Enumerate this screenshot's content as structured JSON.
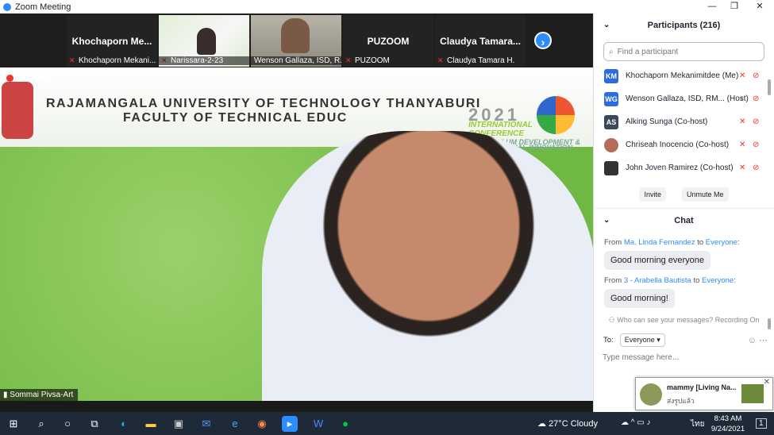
{
  "window": {
    "title": "Zoom Meeting",
    "controls": [
      "—",
      "❐",
      "✕"
    ]
  },
  "strip": {
    "tiles": [
      {
        "bigname": "Khochaporn  Me...",
        "caption": "Khochaporn Mekani..."
      },
      {
        "bigname": "",
        "caption": "Narissara-2-23"
      },
      {
        "bigname": "",
        "caption": "Wenson Gallaza, ISD, R..."
      },
      {
        "bigname": "PUZOOM",
        "caption": "PUZOOM"
      },
      {
        "bigname": "Claudya  Tamara...",
        "caption": "Claudya Tamara H."
      }
    ],
    "next_icon": "›"
  },
  "main": {
    "recording_label": "Recording",
    "speaker_name": "Sommai Pivsa-Art",
    "banner": {
      "university": "RAJAMANGALA UNIVERSITY OF TECHNOLOGY THANYABURI",
      "faculty": "FACULTY OF TECHNICAL EDUC",
      "conf_year": "2021",
      "conf_line1": "INTERNATIONAL",
      "conf_line2": "CONFERENCE",
      "conf_line3": "CURRICULUM DEVELOPMENT &",
      "conf_line4": "INSTRUCTIONAL INNOVATION"
    }
  },
  "participants": {
    "header": "Participants (216)",
    "search_placeholder": "Find a participant",
    "list": [
      {
        "initials": "KM",
        "name": "Khochaporn Mekanimitdee (Me)",
        "color": "#2D6CDF",
        "mic": "off"
      },
      {
        "initials": "WG",
        "name": "Wenson Gallaza, ISD, RM... (Host)",
        "color": "#2D6CDF",
        "mic": "on"
      },
      {
        "initials": "AS",
        "name": "Alking Sunga (Co-host)",
        "color": "#3a4a5c",
        "mic": "off"
      },
      {
        "initials": "",
        "name": "Chriseah Inocencio (Co-host)",
        "color": "#b56a5a",
        "mic": "off"
      },
      {
        "initials": "",
        "name": "John Joven Ramirez (Co-host)",
        "color": "#333333",
        "mic": "off"
      }
    ],
    "invite_label": "Invite",
    "unmute_label": "Unmute Me"
  },
  "chat": {
    "header": "Chat",
    "messages": [
      {
        "from_prefix": "From ",
        "sender": "Ma. Linda Fernandez",
        "to": " to ",
        "recipient": "Everyone",
        "suffix": ":",
        "text": "Good morning everyone"
      },
      {
        "from_prefix": "From ",
        "sender": "3 - Arabella Bautista",
        "to": " to ",
        "recipient": "Everyone",
        "suffix": ":",
        "text": "Good morning!"
      }
    ],
    "who_can_see": "Who can see your messages? Recording On",
    "to_label": "To:",
    "to_value": "Everyone",
    "compose_placeholder": "Type message here..."
  },
  "notification": {
    "title": "mammy [Living Na...",
    "subtitle": "ส่งรูปแล้ว"
  },
  "taskbar": {
    "weather": "27°C  Cloudy",
    "lang": "ไทย",
    "time": "8:43 AM",
    "date": "9/24/2021",
    "notif_count": "1"
  }
}
